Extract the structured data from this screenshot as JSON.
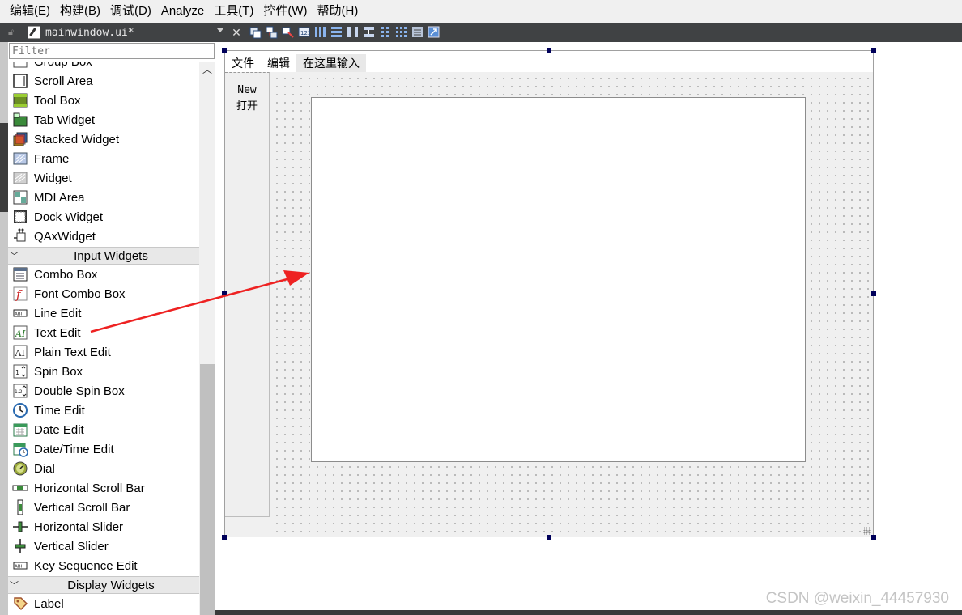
{
  "menubar": {
    "items": [
      "编辑(E)",
      "构建(B)",
      "调试(D)",
      "Analyze",
      "工具(T)",
      "控件(W)",
      "帮助(H)"
    ]
  },
  "toolbar": {
    "file_name": "mainwindow.ui*",
    "icons": [
      "edit-widgets-icon",
      "edit-signals-icon",
      "edit-buddies-icon",
      "edit-tab-order-icon",
      "layout-horizontal-icon",
      "layout-vertical-icon",
      "splitter-horizontal-icon",
      "splitter-vertical-icon",
      "layout-form-icon",
      "layout-grid-icon",
      "break-layout-icon",
      "adjust-size-icon"
    ]
  },
  "widget_box": {
    "filter_placeholder": "Filter",
    "containers_tail": [
      {
        "label": "Group Box",
        "icon": "group-box-icon"
      },
      {
        "label": "Scroll Area",
        "icon": "scroll-area-icon"
      },
      {
        "label": "Tool Box",
        "icon": "tool-box-icon"
      },
      {
        "label": "Tab Widget",
        "icon": "tab-widget-icon"
      },
      {
        "label": "Stacked Widget",
        "icon": "stacked-widget-icon"
      },
      {
        "label": "Frame",
        "icon": "frame-icon"
      },
      {
        "label": "Widget",
        "icon": "widget-icon"
      },
      {
        "label": "MDI Area",
        "icon": "mdi-area-icon"
      },
      {
        "label": "Dock Widget",
        "icon": "dock-widget-icon"
      },
      {
        "label": "QAxWidget",
        "icon": "qaxwidget-icon"
      }
    ],
    "input_category": "Input Widgets",
    "input_widgets": [
      {
        "label": "Combo Box",
        "icon": "combo-box-icon"
      },
      {
        "label": "Font Combo Box",
        "icon": "font-combo-box-icon"
      },
      {
        "label": "Line Edit",
        "icon": "line-edit-icon"
      },
      {
        "label": "Text Edit",
        "icon": "text-edit-icon"
      },
      {
        "label": "Plain Text Edit",
        "icon": "plain-text-edit-icon"
      },
      {
        "label": "Spin Box",
        "icon": "spin-box-icon"
      },
      {
        "label": "Double Spin Box",
        "icon": "double-spin-box-icon"
      },
      {
        "label": "Time Edit",
        "icon": "time-edit-icon"
      },
      {
        "label": "Date Edit",
        "icon": "date-edit-icon"
      },
      {
        "label": "Date/Time Edit",
        "icon": "date-time-edit-icon"
      },
      {
        "label": "Dial",
        "icon": "dial-icon"
      },
      {
        "label": "Horizontal Scroll Bar",
        "icon": "horizontal-scroll-bar-icon"
      },
      {
        "label": "Vertical Scroll Bar",
        "icon": "vertical-scroll-bar-icon"
      },
      {
        "label": "Horizontal Slider",
        "icon": "horizontal-slider-icon"
      },
      {
        "label": "Vertical Slider",
        "icon": "vertical-slider-icon"
      },
      {
        "label": "Key Sequence Edit",
        "icon": "key-sequence-edit-icon"
      }
    ],
    "display_category": "Display Widgets",
    "display_widgets": [
      {
        "label": "Label",
        "icon": "label-icon"
      }
    ]
  },
  "form": {
    "menus": [
      "文件",
      "编辑",
      "在这里输入"
    ],
    "toolbar_actions": [
      "New",
      "打开"
    ]
  },
  "watermark": "CSDN @weixin_44457930",
  "colors": {
    "menubar_bg": "#f0f0f0",
    "toolbar_bg": "#404244",
    "selection_handle": "#00005a",
    "annotation_arrow": "#ee2222"
  }
}
